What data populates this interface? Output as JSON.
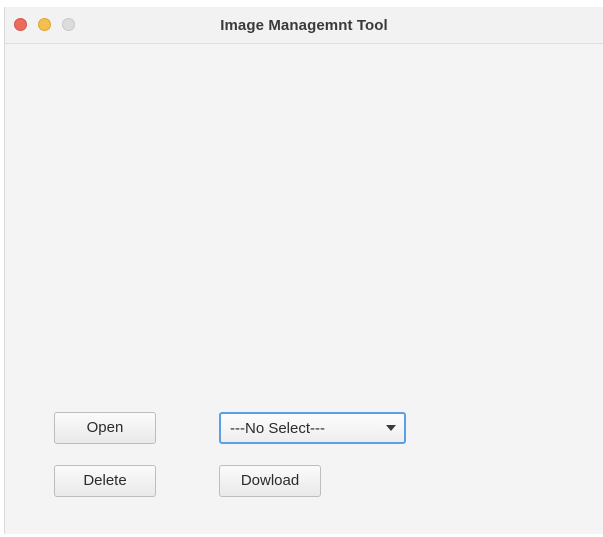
{
  "window": {
    "title": "Image Managemnt Tool"
  },
  "controls": {
    "open_label": "Open",
    "delete_label": "Delete",
    "download_label": "Dowload",
    "select": {
      "selected": "---No Select---"
    }
  },
  "icons": {
    "close": "traffic-light-close-icon",
    "minimize": "traffic-light-minimize-icon",
    "maximize": "traffic-light-maximize-icon",
    "dropdown": "chevron-down-icon"
  },
  "colors": {
    "close": "#ec6a5e",
    "minimize": "#f4bf4f",
    "maximize": "#dcdcdc",
    "focus_ring": "#5aa0e6"
  }
}
